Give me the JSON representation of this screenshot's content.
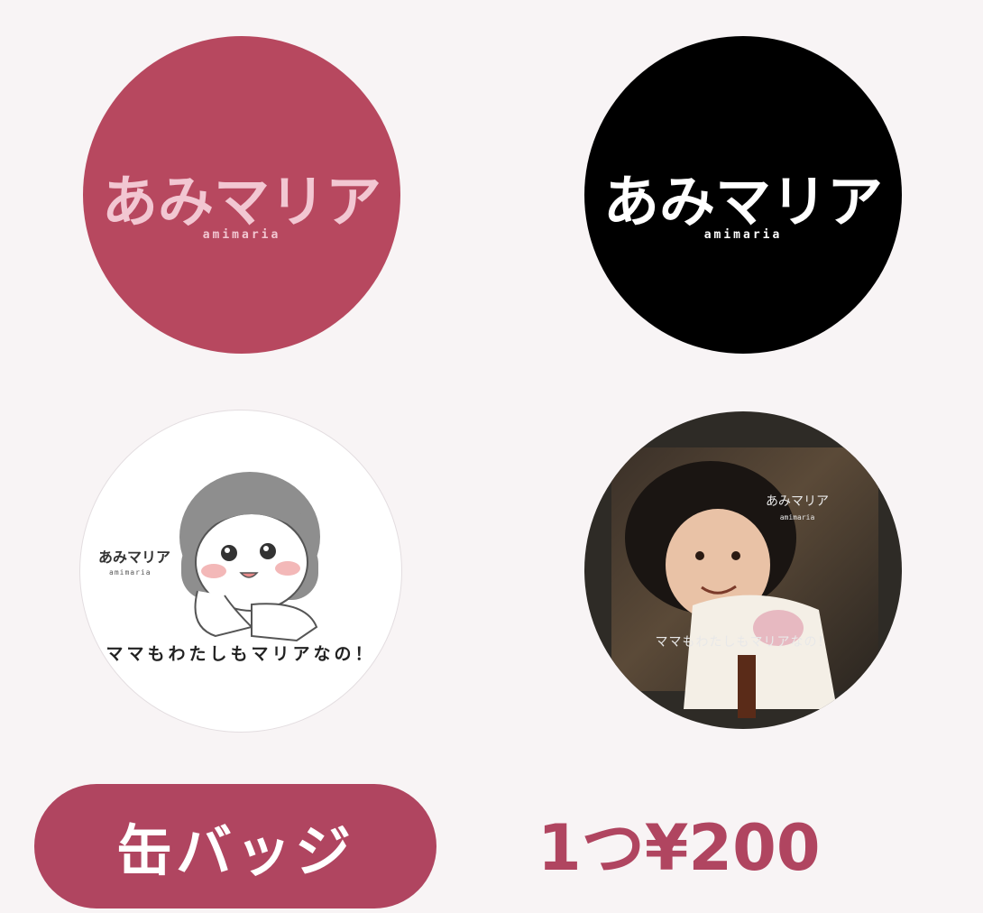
{
  "badges": [
    {
      "name": "pink-logo-badge",
      "logo_text": "あみマリア",
      "logo_sub": "amimaria",
      "bg": "#b7485f",
      "logo_color": "#f2c7d2"
    },
    {
      "name": "black-logo-badge",
      "logo_text": "あみマリア",
      "logo_sub": "amimaria",
      "bg": "#000000",
      "logo_color": "#ffffff"
    },
    {
      "name": "illustration-badge",
      "brand": "あみマリア",
      "brand_sub": "amimaria",
      "caption": "ママもわたしもマリアなの！"
    },
    {
      "name": "photo-badge",
      "brand": "あみマリア",
      "brand_sub": "amimaria",
      "caption": "ママもわたしもマリアなの！"
    }
  ],
  "product": {
    "label": "缶バッジ",
    "price": "1つ¥200"
  },
  "colors": {
    "accent": "#b04560",
    "background": "#f8f4f5"
  }
}
